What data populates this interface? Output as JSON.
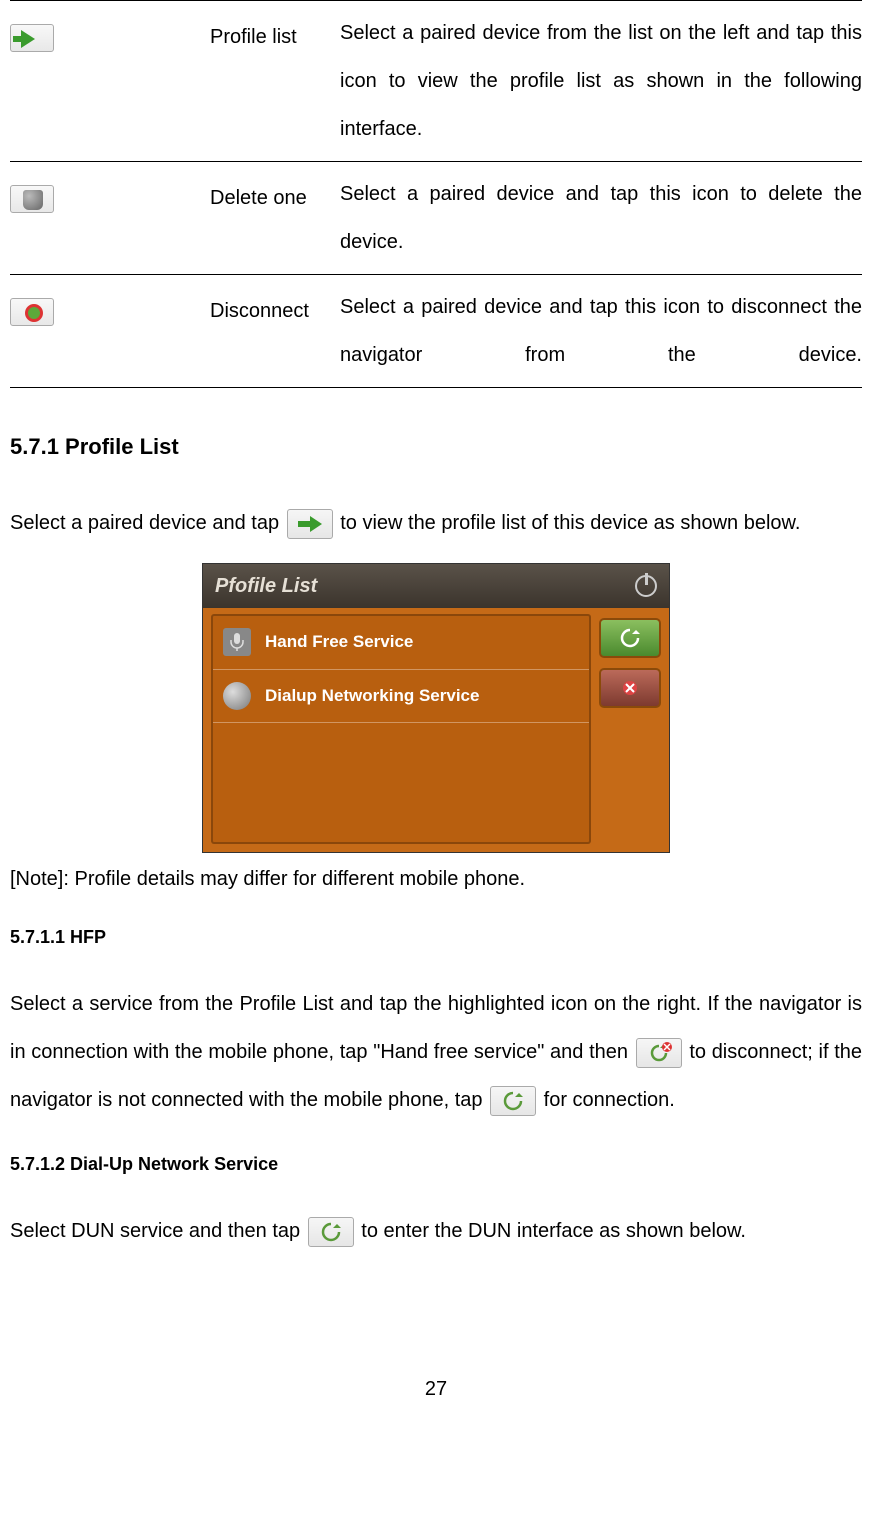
{
  "table": {
    "rows": [
      {
        "label": "Profile list",
        "desc": "Select a paired device from the list on the left and tap this icon to view the profile list as shown in the following interface."
      },
      {
        "label": "Delete one",
        "desc": "Select a paired device and tap this icon to delete the device."
      },
      {
        "label": "Disconnect",
        "desc": "Select a paired device and tap this icon to disconnect the navigator from the device."
      }
    ]
  },
  "h571": "5.7.1 Profile List",
  "para571_a": "Select a paired device and tap ",
  "para571_b": " to view the profile list of this device as shown below.",
  "screenshot": {
    "title": "Pfofile List",
    "items": [
      "Hand Free Service",
      "Dialup Networking Service"
    ]
  },
  "note": "[Note]: Profile details may differ for different mobile phone.",
  "h5711": "5.7.1.1 HFP",
  "para5711_a": "Select a service from the Profile List and tap the highlighted icon on the right. If the navigator is in connection with the mobile phone, tap \"Hand free service\" and then ",
  "para5711_b": " to disconnect; if the navigator is not connected with the mobile phone, tap ",
  "para5711_c": " for connection.",
  "h5712": "5.7.1.2 Dial-Up Network Service",
  "para5712_a": "Select DUN service and then tap ",
  "para5712_b": " to enter the DUN interface as shown below.",
  "pagenum": "27"
}
